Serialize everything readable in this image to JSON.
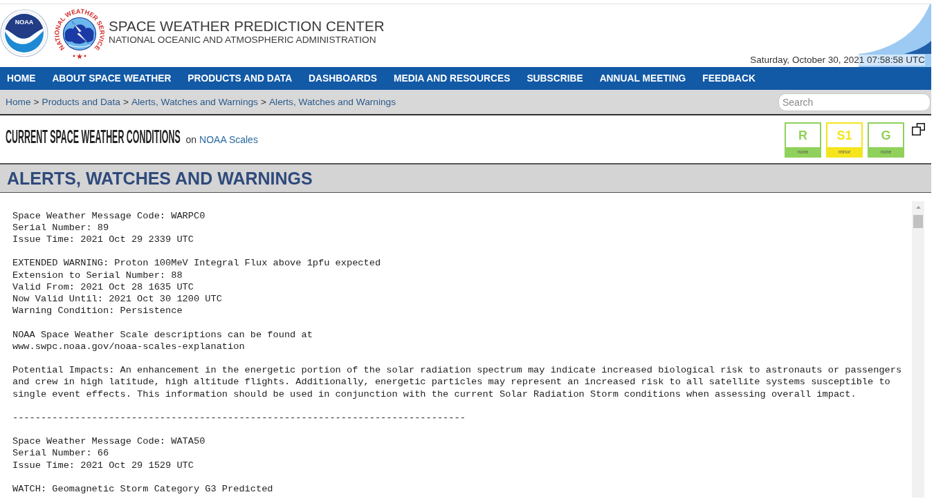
{
  "header": {
    "noaa_logo_text": "NOAA",
    "nws_logo_text": "NATIONAL WEATHER SERVICE",
    "title": "SPACE WEATHER PREDICTION CENTER",
    "subtitle": "NATIONAL OCEANIC AND ATMOSPHERIC ADMINISTRATION",
    "datetime": "Saturday, October 30, 2021 07:58:58 UTC"
  },
  "nav": [
    "HOME",
    "ABOUT SPACE WEATHER",
    "PRODUCTS AND DATA",
    "DASHBOARDS",
    "MEDIA AND RESOURCES",
    "SUBSCRIBE",
    "ANNUAL MEETING",
    "FEEDBACK"
  ],
  "breadcrumb": {
    "separator": ">",
    "items": [
      "Home",
      "Products and Data",
      "Alerts, Watches and Warnings",
      "Alerts, Watches and Warnings"
    ]
  },
  "search": {
    "placeholder": "Search"
  },
  "conditions": {
    "title": "CURRENT SPACE WEATHER CONDITIONS",
    "on": "on",
    "link": "NOAA Scales",
    "scales": [
      {
        "letter": "R",
        "label": "none",
        "color": "#8fd15a"
      },
      {
        "letter": "S1",
        "label": "minor",
        "color": "#f5e51c"
      },
      {
        "letter": "G",
        "label": "none",
        "color": "#8fd15a"
      }
    ]
  },
  "page_title": "ALERTS, WATCHES AND WARNINGS",
  "bulletin": {
    "separator": "--------------------------------------------------------------------------------",
    "messages": [
      {
        "paragraphs": [
          [
            "Space Weather Message Code: WARPC0",
            "Serial Number: 89",
            "Issue Time: 2021 Oct 29 2339 UTC"
          ],
          [
            "EXTENDED WARNING: Proton 100MeV Integral Flux above 1pfu expected",
            "Extension to Serial Number: 88",
            "Valid From: 2021 Oct 28 1635 UTC",
            "Now Valid Until: 2021 Oct 30 1200 UTC",
            "Warning Condition: Persistence"
          ],
          [
            "NOAA Space Weather Scale descriptions can be found at",
            "www.swpc.noaa.gov/noaa-scales-explanation"
          ],
          [
            "Potential Impacts: An enhancement in the energetic portion of the solar radiation spectrum may indicate increased biological risk to astronauts or passengers",
            "and crew in high latitude, high altitude flights. Additionally, energetic particles may represent an increased risk to all satellite systems susceptible to",
            "single event effects. This information should be used in conjunction with the current Solar Radiation Storm conditions when assessing overall impact."
          ]
        ]
      },
      {
        "paragraphs": [
          [
            "Space Weather Message Code: WATA50",
            "Serial Number: 66",
            "Issue Time: 2021 Oct 29 1529 UTC"
          ],
          [
            "WATCH: Geomagnetic Storm Category G3 Predicted"
          ]
        ]
      }
    ]
  }
}
